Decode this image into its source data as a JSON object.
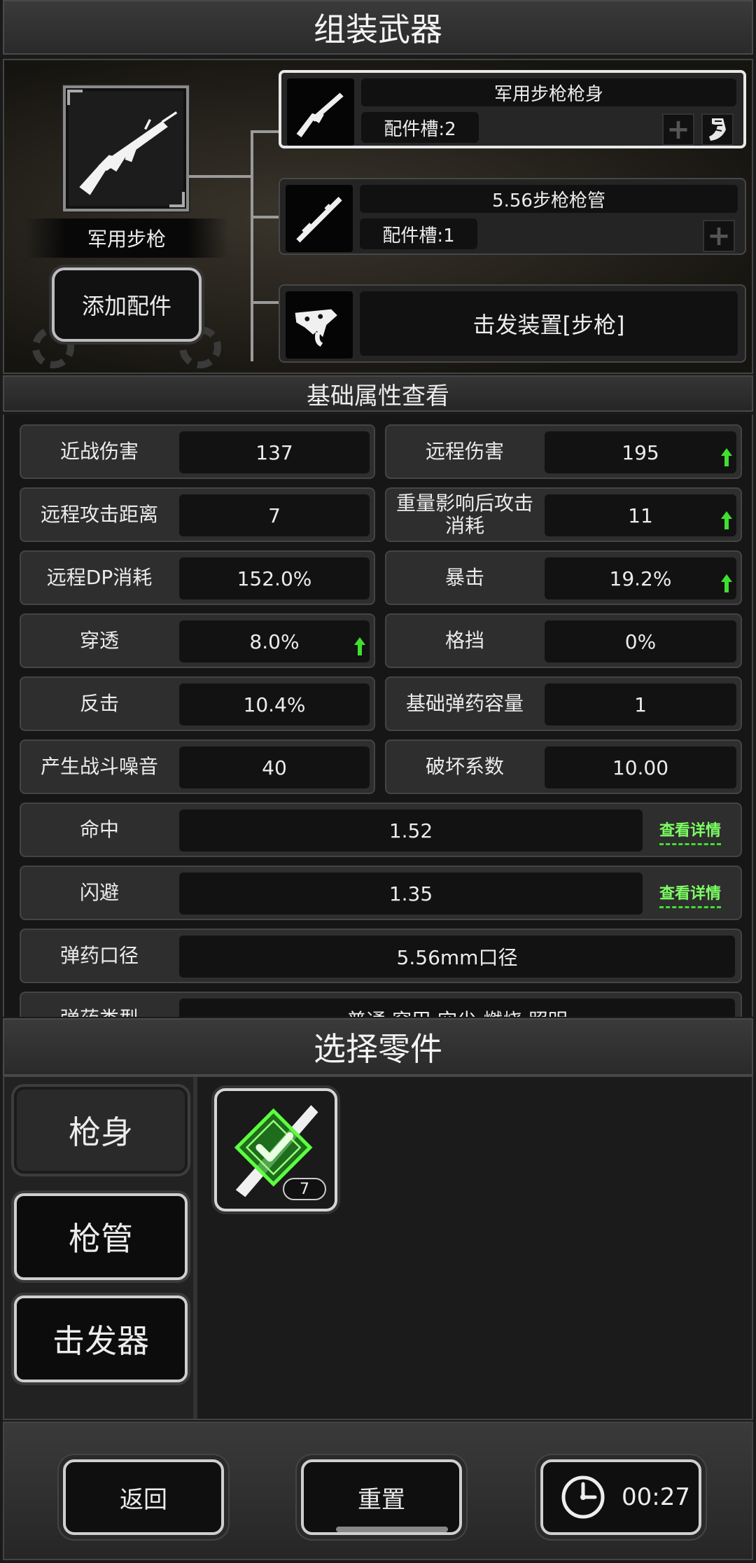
{
  "header": {
    "title": "组装武器"
  },
  "assembly": {
    "weapon_name": "军用步枪",
    "add_part_label": "添加配件",
    "parts": [
      {
        "name": "军用步枪枪身",
        "slot_label": "配件槽:2",
        "icon": "rifle-receiver-icon",
        "selected": true
      },
      {
        "name": "5.56步枪枪管",
        "slot_label": "配件槽:1",
        "icon": "rifle-barrel-icon",
        "selected": false
      },
      {
        "name": "击发装置[步枪]",
        "icon": "trigger-mechanism-icon",
        "selected": false
      }
    ]
  },
  "stats": {
    "title": "基础属性查看",
    "detail_label": "查看详情",
    "grid": [
      {
        "label": "近战伤害",
        "value": "137",
        "up": false
      },
      {
        "label": "远程伤害",
        "value": "195",
        "up": true
      },
      {
        "label": "远程攻击距离",
        "value": "7",
        "up": false
      },
      {
        "label": "重量影响后攻击消耗",
        "value": "11",
        "up": true
      },
      {
        "label": "远程DP消耗",
        "value": "152.0%",
        "up": false
      },
      {
        "label": "暴击",
        "value": "19.2%",
        "up": true
      },
      {
        "label": "穿透",
        "value": "8.0%",
        "up": true
      },
      {
        "label": "格挡",
        "value": "0%",
        "up": false
      },
      {
        "label": "反击",
        "value": "10.4%",
        "up": false
      },
      {
        "label": "基础弹药容量",
        "value": "1",
        "up": false
      },
      {
        "label": "产生战斗噪音",
        "value": "40",
        "up": false
      },
      {
        "label": "破坏系数",
        "value": "10.00",
        "up": false
      }
    ],
    "wide": [
      {
        "label": "命中",
        "value": "1.52",
        "detail": true
      },
      {
        "label": "闪避",
        "value": "1.35",
        "detail": true
      },
      {
        "label": "弹药口径",
        "value": "5.56mm口径",
        "detail": false
      },
      {
        "label": "弹药类型",
        "value": "普通,穿甲,空尖,燃烧,照明",
        "detail": false
      }
    ]
  },
  "select": {
    "title": "选择零件",
    "categories": [
      "枪身",
      "枪管",
      "击发器"
    ],
    "active_category": 0,
    "item": {
      "count": "7",
      "icon": "equipped-check-icon"
    }
  },
  "bottom": {
    "back_label": "返回",
    "reset_label": "重置",
    "timer": "00:27"
  },
  "colors": {
    "accent_green": "#3fe02f",
    "border_light": "#cfcfcf"
  }
}
